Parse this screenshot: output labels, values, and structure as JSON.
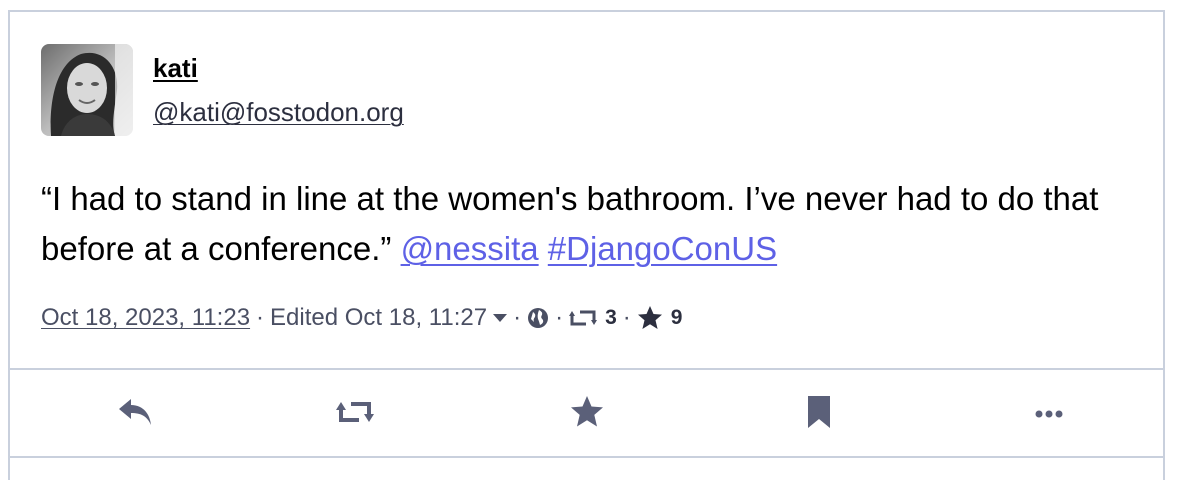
{
  "author": {
    "display_name": "kati",
    "handle": "@kati@fosstodon.org",
    "avatar_icon": "avatar-photo"
  },
  "post": {
    "text": "“I had to stand in line at the women's bathroom. I’ve never had to do that before at a conference.”",
    "mention": "@nessita",
    "hashtag": "#DjangoConUS",
    "link_color": "#5e61e6"
  },
  "meta": {
    "date": "Oct 18, 2023, 11:23",
    "edited": "Edited Oct 18, 11:27",
    "separator": "·",
    "visibility_icon": "globe-icon",
    "boost_icon": "retweet-icon",
    "boosts": "3",
    "favourite_icon": "star-icon",
    "favourites": "9"
  },
  "actions": {
    "icons": [
      "reply-icon",
      "boost-icon",
      "favourite-icon",
      "bookmark-icon",
      "more-icon"
    ],
    "icon_color": "#5b6079"
  },
  "colors": {
    "border": "#c9d0dd",
    "text": "#000000",
    "muted": "#4a4f63"
  }
}
